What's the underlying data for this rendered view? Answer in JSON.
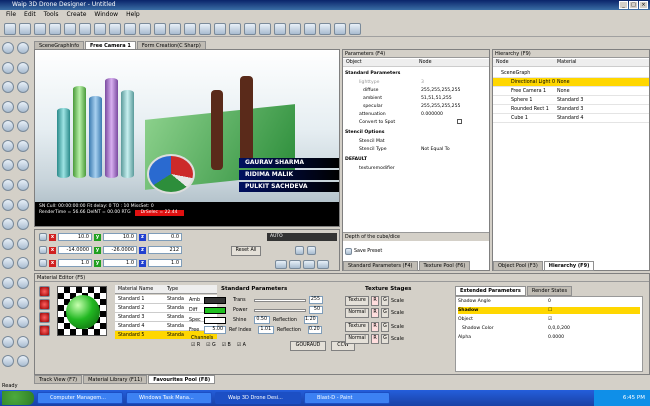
{
  "window": {
    "title": "Waip 3D Drone Designer - Untitled"
  },
  "menu": [
    "File",
    "Edit",
    "Tools",
    "Create",
    "Window",
    "Help"
  ],
  "viewport_tabs": [
    "SceneGraphInfo",
    "Free Camera 1",
    "Form Creation(C Sharp)"
  ],
  "viewport": {
    "names": [
      "GAURAV SHARMA",
      "RIDIMA MALIK",
      "PULKIT SACHDEVA"
    ],
    "stats_line1": "SN Cull: 00:00:00:00 Fit delay: 0 TO : 10 MissSet: 0",
    "stats_line2": "RenderTime = 56.66 DelNT = 00.00 RTG",
    "stats_red": "DrSelec = 22.44"
  },
  "transform": {
    "rows": [
      {
        "x": "10.0",
        "y": "10.0",
        "z": "0.0"
      },
      {
        "x": "-14.0000",
        "y": "-26.0000",
        "z": "212"
      },
      {
        "x": "1.0",
        "y": "1.0",
        "z": "1.0"
      }
    ],
    "reset_all": "Reset All",
    "auto_label": "AUTO"
  },
  "parameters": {
    "title": "Parameters (F4)",
    "headers": [
      "Object",
      "Node"
    ],
    "sections": {
      "standard": "Standard Parameters",
      "stencil": "Stencil Options",
      "default": "DEFAULT"
    },
    "rows": [
      {
        "k": "lighttype",
        "v": "3"
      },
      {
        "k": "diffuse",
        "v": "255,255,255,255"
      },
      {
        "k": "ambient",
        "v": "51,51,51,255"
      },
      {
        "k": "specular",
        "v": "255,255,255,255"
      },
      {
        "k": "attenuation",
        "v": "0.000000"
      },
      {
        "k": "Convert to Spot",
        "v": ""
      },
      {
        "k": "Stencil Mat",
        "v": ""
      },
      {
        "k": "Stencil Type",
        "v": "Not Equal To"
      },
      {
        "k": "texturemodifier",
        "v": ""
      }
    ],
    "depth_label": "Depth of the cube/dice",
    "save_preset": "Save Preset",
    "bottom_tabs": [
      "Standard Parameters (F4)",
      "Texture Pool (F6)"
    ]
  },
  "hierarchy": {
    "title": "Hierarchy (F9)",
    "headers": [
      "Node",
      "Material"
    ],
    "items": [
      {
        "name": "SceneGraph",
        "mat": ""
      },
      {
        "name": "Directional Light 0",
        "mat": "None"
      },
      {
        "name": "Free Camera 1",
        "mat": "None"
      },
      {
        "name": "Sphere 1",
        "mat": "Standard 3"
      },
      {
        "name": "Rounded Rect 1",
        "mat": "Standard 3"
      },
      {
        "name": "Cube 1",
        "mat": "Standard 4"
      }
    ],
    "bottom_tabs": [
      "Object Pool (F3)",
      "Hierarchy (F9)"
    ]
  },
  "material_editor": {
    "title": "Material Editor (F5)",
    "headers": [
      "Material Name",
      "Type"
    ],
    "rows": [
      {
        "n": "Standard 1",
        "t": "Standa"
      },
      {
        "n": "Standard 2",
        "t": "Standa"
      },
      {
        "n": "Standard 3",
        "t": "Standa"
      },
      {
        "n": "Standard 4",
        "t": "Standa"
      },
      {
        "n": "Standard 5",
        "t": "Standa"
      }
    ],
    "std_params": "Standard Parameters",
    "amb": "Amb",
    "diff": "Diff",
    "spec": "Spec",
    "free": "Free",
    "trans": "Trans",
    "trans_val": "255",
    "power": "Power",
    "power_val": "50",
    "shine": "Shine",
    "shine_val": "0.50",
    "reflection": "Reflection",
    "reflection_val": "1.20",
    "spec_val": "5.00",
    "ref_index": "Ref Index",
    "ref_index_val": "1.01",
    "reflection2": "Reflection",
    "reflection2_val": "0.20",
    "channels": "Channels",
    "ch": [
      "R",
      "G",
      "B",
      "A"
    ],
    "gouraud": "GOURAUD",
    "ccw": "CCW",
    "texture_stages": "Texture Stages",
    "texture": "Texture",
    "normal": "Normal",
    "scale": "Scale",
    "ext_tabs": [
      "Extended Parameters",
      "Render States"
    ],
    "shadow_angle": "Shadow Angle",
    "shadow_angle_val": "0",
    "shadow": "Shadow",
    "object": "Object",
    "shadow_color": "Shadow Color",
    "shadow_color_val": "0,0,0,200",
    "alpha": "Alpha",
    "alpha_val": "0.0000"
  },
  "bottom_tabs": [
    "Track View (F7)",
    "Material Library (F11)",
    "Favourites Pool (F8)"
  ],
  "status": "Ready",
  "taskbar": {
    "items": [
      "Computer Managem...",
      "Windows Task Mana...",
      "Waip 3D Drone Desi...",
      "Blast-D - Paint"
    ],
    "time": "6:45 PM"
  },
  "colors": {
    "accent_yellow": "#ffd700",
    "title_blue": "#0a246a"
  }
}
